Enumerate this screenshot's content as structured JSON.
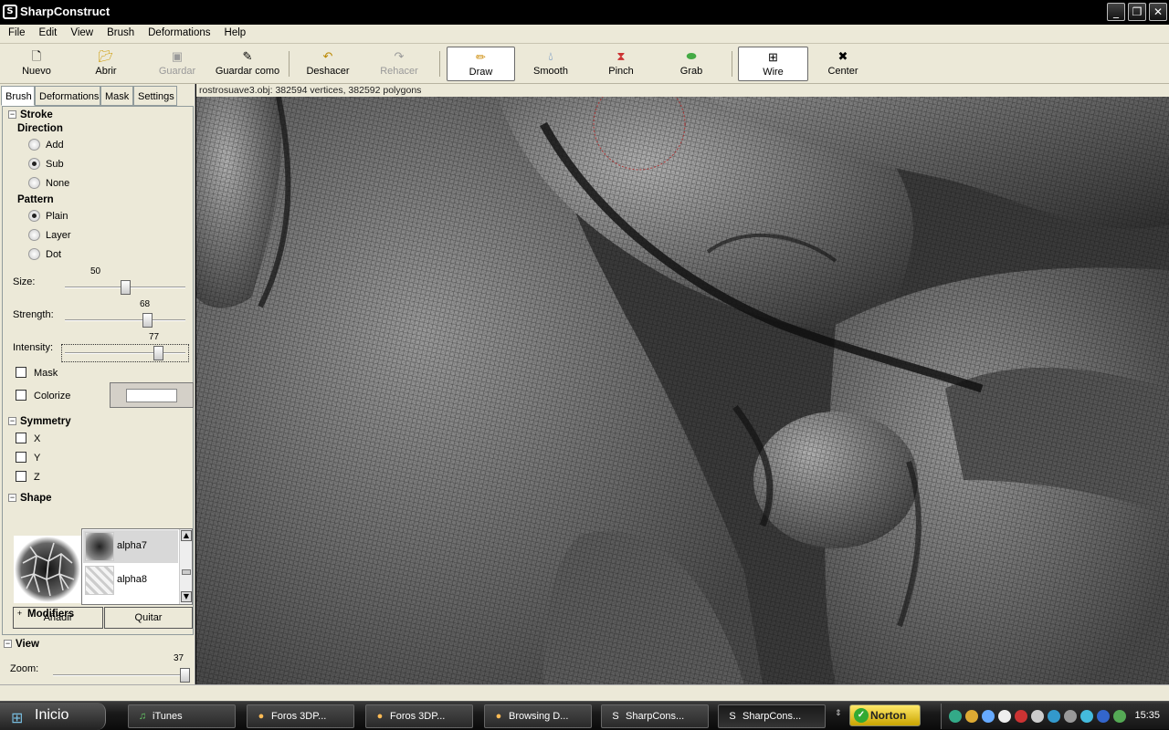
{
  "window": {
    "title": "SharpConstruct",
    "icon": "sharpconstruct-logo-icon"
  },
  "menu": [
    "File",
    "Edit",
    "View",
    "Brush",
    "Deformations",
    "Help"
  ],
  "toolbar": {
    "buttons": [
      {
        "label": "Nuevo",
        "icon": "new-file-icon",
        "state": "normal"
      },
      {
        "label": "Abrir",
        "icon": "open-folder-icon",
        "state": "normal"
      },
      {
        "label": "Guardar",
        "icon": "save-icon",
        "state": "disabled"
      },
      {
        "label": "Guardar como",
        "icon": "save-as-icon",
        "state": "normal"
      },
      {
        "label": "Deshacer",
        "icon": "undo-icon",
        "state": "normal"
      },
      {
        "label": "Rehacer",
        "icon": "redo-icon",
        "state": "disabled"
      },
      {
        "label": "Draw",
        "icon": "pencil-icon",
        "state": "active"
      },
      {
        "label": "Smooth",
        "icon": "droplet-icon",
        "state": "normal"
      },
      {
        "label": "Pinch",
        "icon": "pinch-icon",
        "state": "normal"
      },
      {
        "label": "Grab",
        "icon": "grab-icon",
        "state": "normal"
      },
      {
        "label": "Wire",
        "icon": "wire-grid-icon",
        "state": "active"
      },
      {
        "label": "Center",
        "icon": "center-icon",
        "state": "normal"
      }
    ]
  },
  "tabs": [
    "Brush",
    "Deformations",
    "Mask",
    "Settings"
  ],
  "stroke": {
    "title": "Stroke",
    "direction_label": "Direction",
    "direction_options": [
      "Add",
      "Sub",
      "None"
    ],
    "direction_selected": "Sub",
    "pattern_label": "Pattern",
    "pattern_options": [
      "Plain",
      "Layer",
      "Dot"
    ],
    "pattern_selected": "Plain",
    "size": {
      "label": "Size:",
      "value": "50",
      "fraction": 0.5
    },
    "strength": {
      "label": "Strength:",
      "value": "68",
      "fraction": 0.68
    },
    "intensity": {
      "label": "Intensity:",
      "value": "77",
      "fraction": 0.77
    },
    "mask_label": "Mask",
    "colorize_label": "Colorize",
    "colorize_color": "#ffffff"
  },
  "symmetry": {
    "title": "Symmetry",
    "axes": [
      "X",
      "Y",
      "Z"
    ]
  },
  "shape": {
    "title": "Shape",
    "alphas": [
      {
        "name": "alpha7",
        "selected": true
      },
      {
        "name": "alpha8",
        "selected": false
      }
    ],
    "add_label": "Añadir",
    "remove_label": "Quitar",
    "modifiers_label": "Modifiers"
  },
  "view": {
    "title": "View",
    "zoom": {
      "label": "Zoom:",
      "value": "37",
      "fraction": 0.97
    }
  },
  "viewport": {
    "info": "rostrosuave3.obj: 382594 vertices, 382592 polygons"
  },
  "taskbar": {
    "start_label": "Inicio",
    "tasks": [
      {
        "label": "iTunes",
        "icon": "itunes-icon"
      },
      {
        "label": "Foros 3DP...",
        "icon": "firefox-icon"
      },
      {
        "label": "Foros 3DP...",
        "icon": "firefox-icon"
      },
      {
        "label": "Browsing D...",
        "icon": "firefox-icon"
      },
      {
        "label": "SharpCons...",
        "icon": "sharpconstruct-icon"
      },
      {
        "label": "SharpCons...",
        "icon": "sharpconstruct-icon"
      }
    ],
    "norton_label": "Norton",
    "clock": "15:35"
  }
}
